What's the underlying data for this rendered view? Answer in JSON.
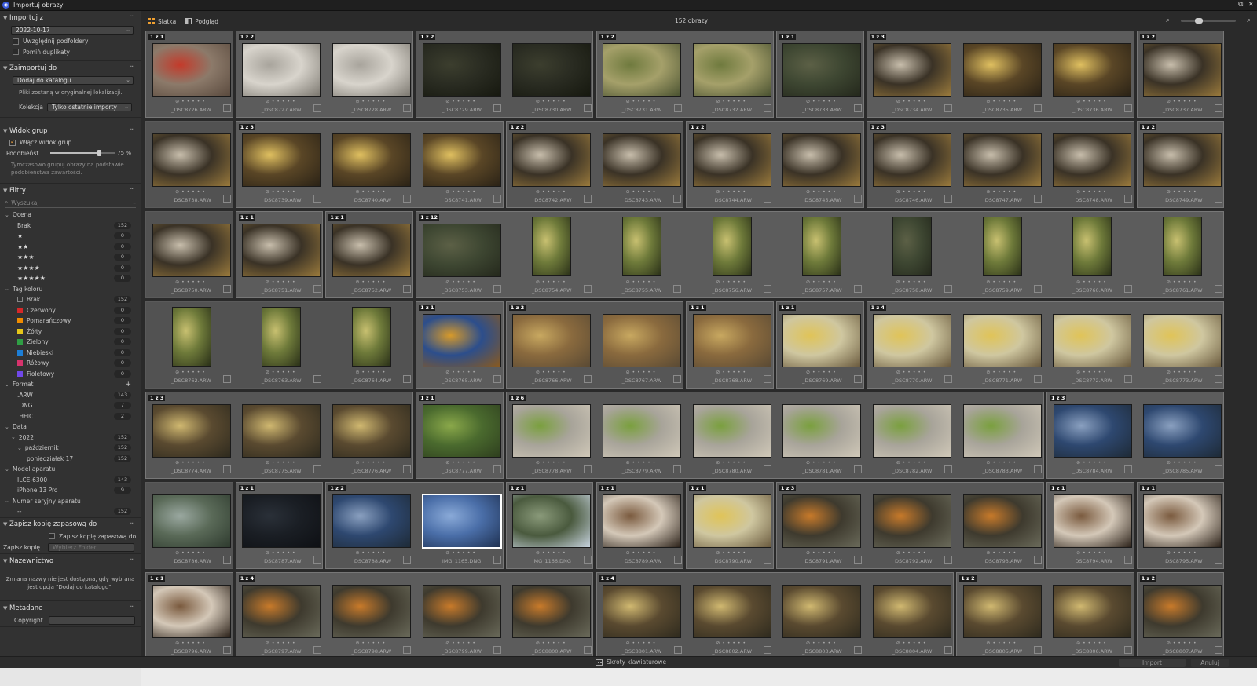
{
  "window": {
    "title": "Importuj obrazy"
  },
  "sidebar": {
    "import_from": {
      "title": "Importuj z",
      "folder": "2022-10-17",
      "include_subfolders": "Uwzględnij podfoldery",
      "skip_duplicates": "Pomiń duplikaty"
    },
    "import_to": {
      "title": "Zaimportuj do",
      "mode": "Dodaj do katalogu",
      "note": "Pliki zostaną w oryginalnej lokalizacji.",
      "collection_label": "Kolekcja",
      "collection_value": "Tylko ostatnie importy"
    },
    "group_view": {
      "title": "Widok grup",
      "enable": "Włącz widok grup",
      "similarity_label": "Podobieńst...",
      "similarity_value": "75 %",
      "similarity_fraction": 0.75,
      "note": "Tymczasowo grupuj obrazy na podstawie podobieństwa zawartości."
    },
    "filters": {
      "title": "Filtry",
      "search_placeholder": "Wyszukaj",
      "rating": {
        "title": "Ocena",
        "items": [
          {
            "label": "Brak",
            "stars": "",
            "count": "152"
          },
          {
            "label": "",
            "stars": "★",
            "count": "0"
          },
          {
            "label": "",
            "stars": "★★",
            "count": "0"
          },
          {
            "label": "",
            "stars": "★★★",
            "count": "0"
          },
          {
            "label": "",
            "stars": "★★★★",
            "count": "0"
          },
          {
            "label": "",
            "stars": "★★★★★",
            "count": "0"
          }
        ]
      },
      "color_tag": {
        "title": "Tag koloru",
        "items": [
          {
            "label": "Brak",
            "color": "",
            "count": "152"
          },
          {
            "label": "Czerwony",
            "color": "#d62828",
            "count": "0"
          },
          {
            "label": "Pomarańczowy",
            "color": "#f08c00",
            "count": "0"
          },
          {
            "label": "Żółty",
            "color": "#e6c619",
            "count": "0"
          },
          {
            "label": "Zielony",
            "color": "#2f9e44",
            "count": "0"
          },
          {
            "label": "Niebieski",
            "color": "#1c7ed6",
            "count": "0"
          },
          {
            "label": "Różowy",
            "color": "#d6336c",
            "count": "0"
          },
          {
            "label": "Fioletowy",
            "color": "#7048e8",
            "count": "0"
          }
        ]
      },
      "format": {
        "title": "Format",
        "items": [
          {
            "label": ".ARW",
            "count": "143"
          },
          {
            "label": ".DNG",
            "count": "7"
          },
          {
            "label": ".HEIC",
            "count": "2"
          }
        ]
      },
      "date": {
        "title": "Data",
        "items": [
          {
            "label": "2022",
            "count": "152"
          },
          {
            "label": "październik",
            "count": "152"
          },
          {
            "label": "poniedziałek 17",
            "count": "152"
          }
        ]
      },
      "camera": {
        "title": "Model aparatu",
        "items": [
          {
            "label": "ILCE-6300",
            "count": "143"
          },
          {
            "label": "iPhone 13 Pro",
            "count": "9"
          }
        ]
      },
      "serial": {
        "title": "Numer seryjny aparatu",
        "items": [
          {
            "label": "--",
            "count": "152"
          }
        ]
      }
    },
    "backup": {
      "title": "Zapisz kopię zapasową do",
      "check_label": "Zapisz kopię zapasową do",
      "folder_label": "Zapisz kopię...",
      "folder_placeholder": "Wybierz Folder..."
    },
    "naming": {
      "title": "Nazewnictwo",
      "note": "Zmiana nazwy nie jest dostępna, gdy wybrana jest opcja \"Dodaj do katalogu\"."
    },
    "metadata": {
      "title": "Metadane",
      "copyright_label": "Copyright"
    }
  },
  "toolbar": {
    "grid_label": "Siatka",
    "preview_label": "Podgląd",
    "count": "152 obrazy"
  },
  "bottom": {
    "shortcuts": "Skróty klawiaturowe",
    "import_btn": "Import",
    "cancel_btn": "Anuluj"
  },
  "icons": {
    "search": "search-icon",
    "grid": "grid-icon",
    "preview": "preview-icon",
    "keyboard": "keyboard-icon"
  },
  "rows": [
    {
      "groups": [
        {
          "badge": "1 z 1",
          "items": [
            "_DSC8726.ARW"
          ]
        },
        {
          "badge": "1 z 2",
          "items": [
            "_DSC8727.ARW",
            "_DSC8728.ARW"
          ]
        },
        {
          "badge": "1 z 2",
          "items": [
            "_DSC8729.ARW",
            "_DSC8730.ARW"
          ]
        },
        {
          "badge": "1 z 2",
          "items": [
            "_DSC8731.ARW",
            "_DSC8732.ARW"
          ]
        },
        {
          "badge": "1 z 1",
          "items": [
            "_DSC8733.ARW"
          ]
        },
        {
          "badge": "1 z 3",
          "items": [
            "_DSC8734.ARW",
            "_DSC8735.ARW",
            "_DSC8736.ARW"
          ]
        },
        {
          "badge": "1 z 2",
          "items": [
            "_DSC8737.ARW"
          ]
        }
      ]
    },
    {
      "groups": [
        {
          "badge": "",
          "items": [
            "_DSC8738.ARW"
          ]
        },
        {
          "badge": "1 z 3",
          "items": [
            "_DSC8739.ARW",
            "_DSC8740.ARW",
            "_DSC8741.ARW"
          ]
        },
        {
          "badge": "1 z 2",
          "items": [
            "_DSC8742.ARW",
            "_DSC8743.ARW"
          ]
        },
        {
          "badge": "1 z 2",
          "items": [
            "_DSC8744.ARW",
            "_DSC8745.ARW"
          ]
        },
        {
          "badge": "1 z 3",
          "items": [
            "_DSC8746.ARW",
            "_DSC8747.ARW",
            "_DSC8748.ARW"
          ]
        },
        {
          "badge": "1 z 2",
          "items": [
            "_DSC8749.ARW"
          ]
        }
      ]
    },
    {
      "groups": [
        {
          "badge": "",
          "items": [
            "_DSC8750.ARW"
          ]
        },
        {
          "badge": "1 z 1",
          "items": [
            "_DSC8751.ARW"
          ]
        },
        {
          "badge": "1 z 1",
          "items": [
            "_DSC8752.ARW"
          ]
        },
        {
          "badge": "1 z 12",
          "items": [
            "_DSC8753.ARW",
            "_DSC8754.ARW",
            "_DSC8755.ARW",
            "_DSC8756.ARW",
            "_DSC8757.ARW",
            "_DSC8758.ARW",
            "_DSC8759.ARW",
            "_DSC8760.ARW",
            "_DSC8761.ARW"
          ]
        }
      ]
    },
    {
      "groups": [
        {
          "badge": "",
          "items": [
            "_DSC8762.ARW",
            "_DSC8763.ARW",
            "_DSC8764.ARW"
          ]
        },
        {
          "badge": "1 z 1",
          "items": [
            "_DSC8765.ARW"
          ]
        },
        {
          "badge": "1 z 2",
          "items": [
            "_DSC8766.ARW",
            "_DSC8767.ARW"
          ]
        },
        {
          "badge": "1 z 1",
          "items": [
            "_DSC8768.ARW"
          ]
        },
        {
          "badge": "1 z 1",
          "items": [
            "_DSC8769.ARW"
          ]
        },
        {
          "badge": "1 z 4",
          "items": [
            "_DSC8770.ARW",
            "_DSC8771.ARW",
            "_DSC8772.ARW",
            "_DSC8773.ARW"
          ]
        }
      ]
    },
    {
      "groups": [
        {
          "badge": "1 z 3",
          "items": [
            "_DSC8774.ARW",
            "_DSC8775.ARW",
            "_DSC8776.ARW"
          ]
        },
        {
          "badge": "1 z 1",
          "items": [
            "_DSC8777.ARW"
          ]
        },
        {
          "badge": "1 z 6",
          "items": [
            "_DSC8778.ARW",
            "_DSC8779.ARW",
            "_DSC8780.ARW",
            "_DSC8781.ARW",
            "_DSC8782.ARW",
            "_DSC8783.ARW"
          ]
        },
        {
          "badge": "1 z 3",
          "items": [
            "_DSC8784.ARW",
            "_DSC8785.ARW"
          ]
        }
      ]
    },
    {
      "groups": [
        {
          "badge": "",
          "items": [
            "_DSC8786.ARW"
          ]
        },
        {
          "badge": "1 z 1",
          "items": [
            "_DSC8787.ARW"
          ]
        },
        {
          "badge": "1 z 2",
          "items": [
            "_DSC8788.ARW",
            "IMG_1165.DNG"
          ]
        },
        {
          "badge": "1 z 1",
          "items": [
            "IMG_1166.DNG"
          ]
        },
        {
          "badge": "1 z 1",
          "items": [
            "_DSC8789.ARW"
          ]
        },
        {
          "badge": "1 z 1",
          "items": [
            "_DSC8790.ARW"
          ]
        },
        {
          "badge": "1 z 3",
          "items": [
            "_DSC8791.ARW",
            "_DSC8792.ARW",
            "_DSC8793.ARW"
          ]
        },
        {
          "badge": "1 z 1",
          "items": [
            "_DSC8794.ARW"
          ]
        },
        {
          "badge": "1 z 1",
          "items": [
            "_DSC8795.ARW"
          ]
        }
      ]
    },
    {
      "groups": [
        {
          "badge": "1 z 1",
          "items": [
            "_DSC8796.ARW"
          ]
        },
        {
          "badge": "1 z 4",
          "items": [
            "_DSC8797.ARW",
            "_DSC8798.ARW",
            "_DSC8799.ARW",
            "_DSC8800.ARW"
          ]
        },
        {
          "badge": "1 z 4",
          "items": [
            "_DSC8801.ARW",
            "_DSC8802.ARW",
            "_DSC8803.ARW",
            "_DSC8804.ARW"
          ]
        },
        {
          "badge": "1 z 2",
          "items": [
            "_DSC8805.ARW",
            "_DSC8806.ARW"
          ]
        },
        {
          "badge": "1 z 2",
          "items": [
            "_DSC8807.ARW"
          ]
        }
      ]
    }
  ]
}
